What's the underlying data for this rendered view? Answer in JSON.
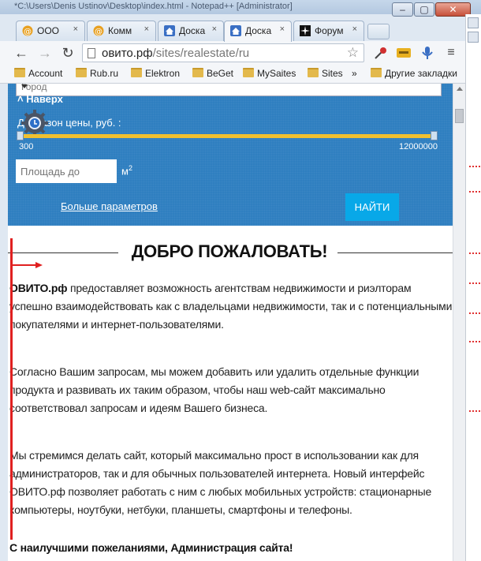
{
  "window": {
    "title": "*C:\\Users\\Denis Ustinov\\Desktop\\index.html - Notepad++ [Administrator]",
    "min_label": "–",
    "max_label": "▢",
    "close_label": "✕"
  },
  "tabs": [
    {
      "title": "ООО",
      "icon": "at-sign-icon"
    },
    {
      "title": "Комм",
      "icon": "at-sign-icon"
    },
    {
      "title": "Доска",
      "icon": "house-icon"
    },
    {
      "title": "Доска",
      "icon": "house-icon",
      "active": true
    },
    {
      "title": "Форум",
      "icon": "star-icon"
    }
  ],
  "tab_close": "×",
  "toolbar": {
    "url_host": "овито.рф",
    "url_path": "/sites/realestate/ru"
  },
  "bookmarks": {
    "items": [
      "Account",
      "Rub.ru",
      "Elektron",
      "BeGet",
      "MySaites",
      "Sites"
    ],
    "overflow": "»",
    "other": "Другие закладки"
  },
  "search_panel": {
    "city_placeholder": "Город",
    "back_to_top": "˄ Наверх",
    "price_label": "Диапазон цены, руб. :",
    "price_min": "300",
    "price_max": "12000000",
    "price_range_fraction": [
      0,
      1
    ],
    "area_placeholder": "Площадь до",
    "area_unit": "м",
    "area_unit_sup": "2",
    "more_params": "Больше параметров",
    "find_button": "НАЙТИ"
  },
  "article": {
    "heading": "ДОБРО ПОЖАЛОВАТЬ!",
    "p1_brand": "ОВИТО.рф",
    "p1_rest": " предоставляет возможность агентствам недвижимости и риэлторам успешно взаимодействовать как с владельцами недвижимости, так и с потенциальными покупателями и интернет-пользователями.",
    "p2": "Согласно Вашим запросам, мы можем добавить или удалить отдельные функции продукта и развивать их таким образом, чтобы наш web-сайт максимально соответствовал запросам и идеям Вашего бизнеса.",
    "p3": "Мы стремимся делать сайт, который максимально прост в использовании как для администраторов, так и для обычных пользователей интернета. Новый интерфейс ОВИТО.рф позволяет работать с ним с любых мобильных устройств: стационарные компьютеры, ноутбуки, нетбуки, планшеты, смартфоны и телефоны.",
    "signature": "С наилучшими пожеланиями, Администрация сайта!"
  },
  "colors": {
    "panel_blue": "#2f7fc0",
    "find_button": "#08a8e8",
    "range_track": "#f0c030",
    "annotation_red": "#e02020"
  }
}
